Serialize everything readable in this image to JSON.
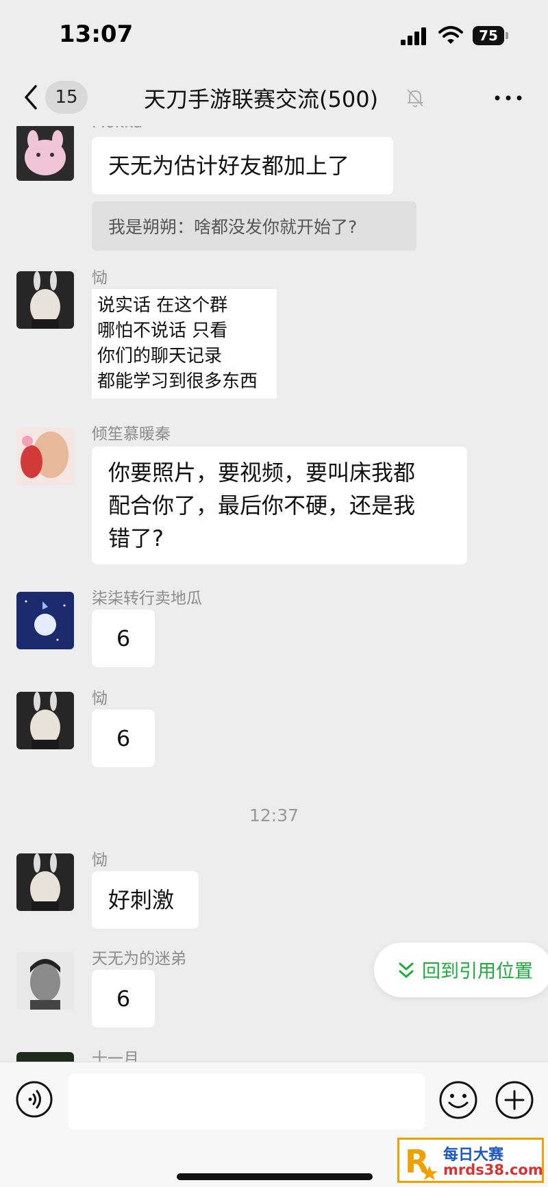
{
  "status_bar": {
    "time": "13:07",
    "battery": "75"
  },
  "header": {
    "unread_count": "15",
    "title": "天刀手游联赛交流(500)"
  },
  "messages": [
    {
      "sender": "Mokka",
      "text": "天无为估计好友都加上了",
      "quote": "我是朔朔：啥都没发你就开始了?"
    },
    {
      "sender": "恸",
      "lines": [
        "说实话  在这个群",
        "哪怕不说话  只看",
        "你们的聊天记录",
        "都能学习到很多东西"
      ]
    },
    {
      "sender": "倾笙慕暖秦",
      "lines": [
        "你要照片，要视频，要叫床我都",
        "配合你了，最后你不硬，还是我",
        "错了?"
      ]
    },
    {
      "sender": "柒柒转行卖地瓜",
      "text": "6"
    },
    {
      "sender": "恸",
      "text": "6"
    },
    {
      "timestamp": "12:37"
    },
    {
      "sender": "恸",
      "text": "好刺激"
    },
    {
      "sender": "天无为的迷弟",
      "text": "6"
    },
    {
      "sender": "十一月"
    }
  ],
  "jump_button": {
    "label": "回到引用位置"
  },
  "watermark": {
    "top": "每日大赛",
    "bottom": "mrds38.com",
    "logo": "R"
  },
  "colors": {
    "background": "#ededed",
    "bubble": "#ffffff",
    "accent": "#1aad3b",
    "quote_bg": "#e0e0e0"
  },
  "icons": [
    "back-icon",
    "mute-bell-icon",
    "more-icon",
    "voice-icon",
    "emoji-icon",
    "plus-icon",
    "double-chevron-down-icon"
  ]
}
